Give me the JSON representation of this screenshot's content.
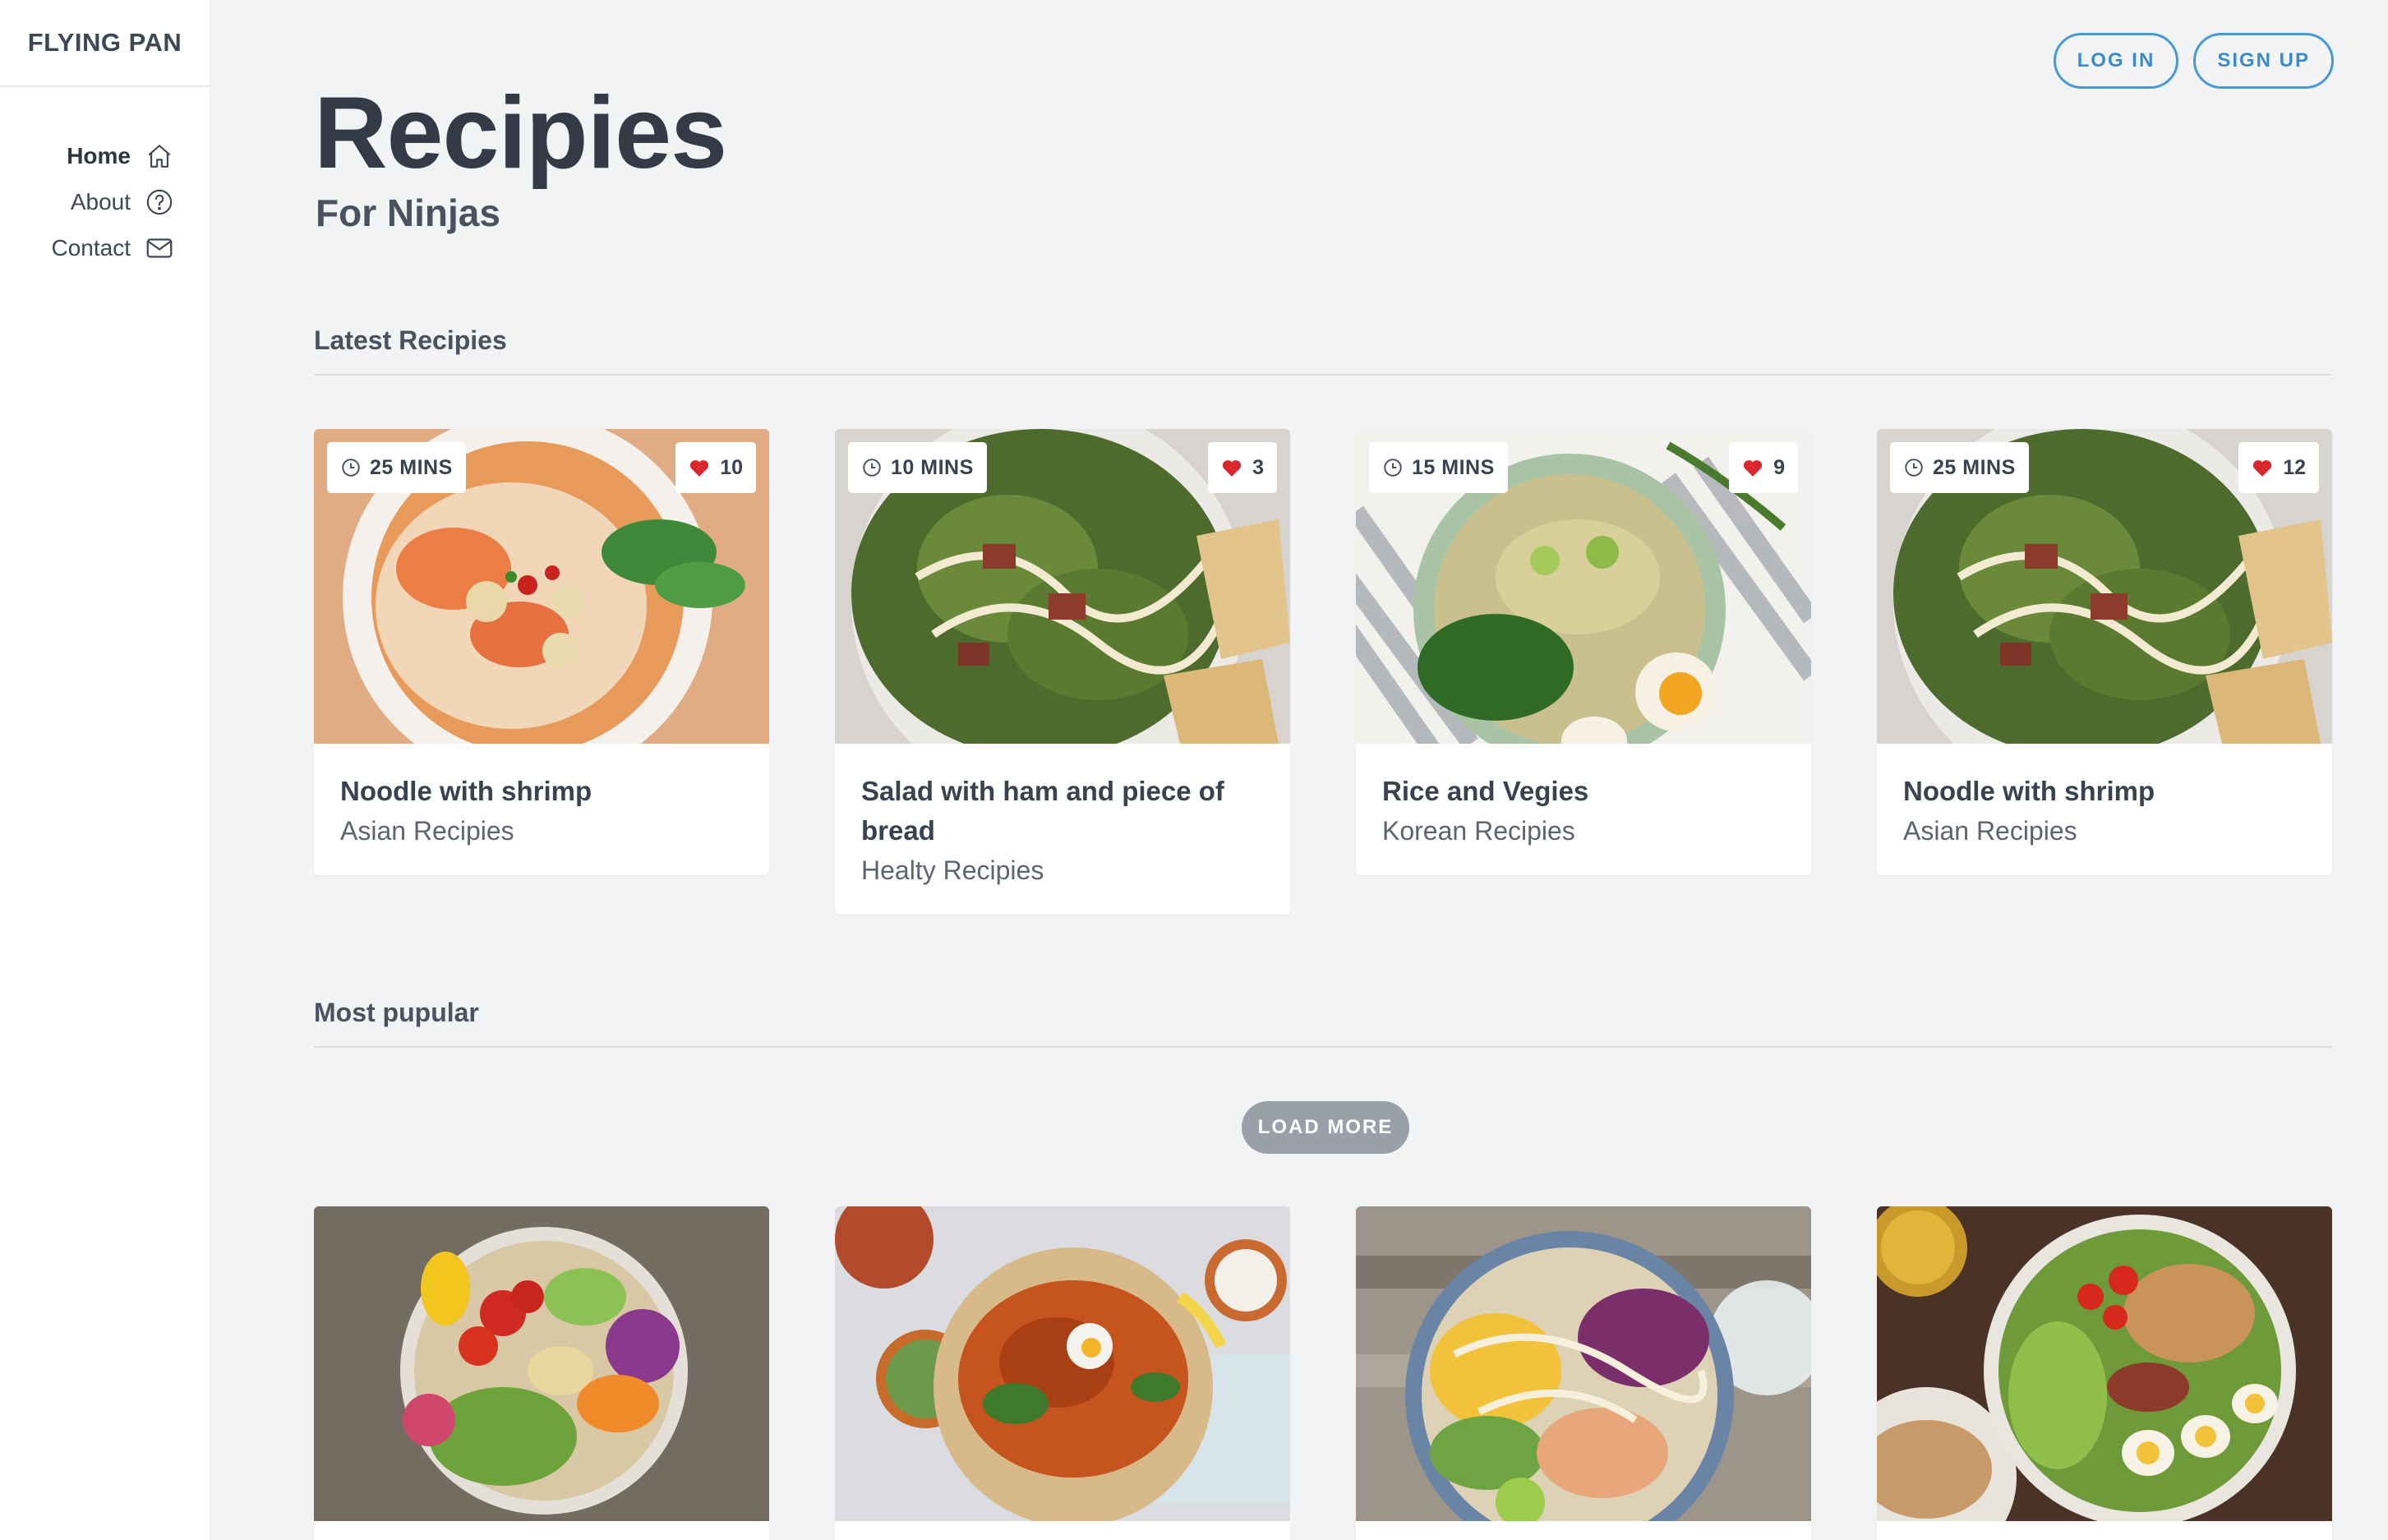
{
  "brand": "FLYING PAN",
  "nav": [
    {
      "label": "Home",
      "icon": "home-icon",
      "active": true
    },
    {
      "label": "About",
      "icon": "help-circle-icon",
      "active": false
    },
    {
      "label": "Contact",
      "icon": "mail-icon",
      "active": false
    }
  ],
  "auth": {
    "login": "LOG IN",
    "signup": "SIGN UP"
  },
  "hero": {
    "title": "Recipies",
    "subtitle": "For Ninjas"
  },
  "sections": {
    "latest": "Latest Recipies",
    "popular": "Most pupular"
  },
  "latest_cards": [
    {
      "time": "25 MINS",
      "likes": "10",
      "title": "Noodle with shrimp",
      "category": "Asian Recipies",
      "image": "noodle-shrimp-photo"
    },
    {
      "time": "10 MINS",
      "likes": "3",
      "title": "Salad with ham and piece of bread",
      "category": "Healty Recipies",
      "image": "salad-ham-photo"
    },
    {
      "time": "15 MINS",
      "likes": "9",
      "title": "Rice and Vegies",
      "category": "Korean Recipies",
      "image": "rice-vegies-photo"
    },
    {
      "time": "25 MINS",
      "likes": "12",
      "title": "Noodle with shrimp",
      "category": "Asian Recipies",
      "image": "salad-ham-photo"
    }
  ],
  "load_more": "LOAD MORE",
  "popular_cards": [
    {
      "image": "buddha-bowl-photo"
    },
    {
      "image": "sweet-potato-fries-photo"
    },
    {
      "image": "shrimp-bowl-photo"
    },
    {
      "image": "cobb-salad-photo"
    }
  ],
  "colors": {
    "accent": "#4a98d2",
    "heart": "#d9272e",
    "background": "#f2f3f5",
    "load_more": "#9aa0aa"
  }
}
